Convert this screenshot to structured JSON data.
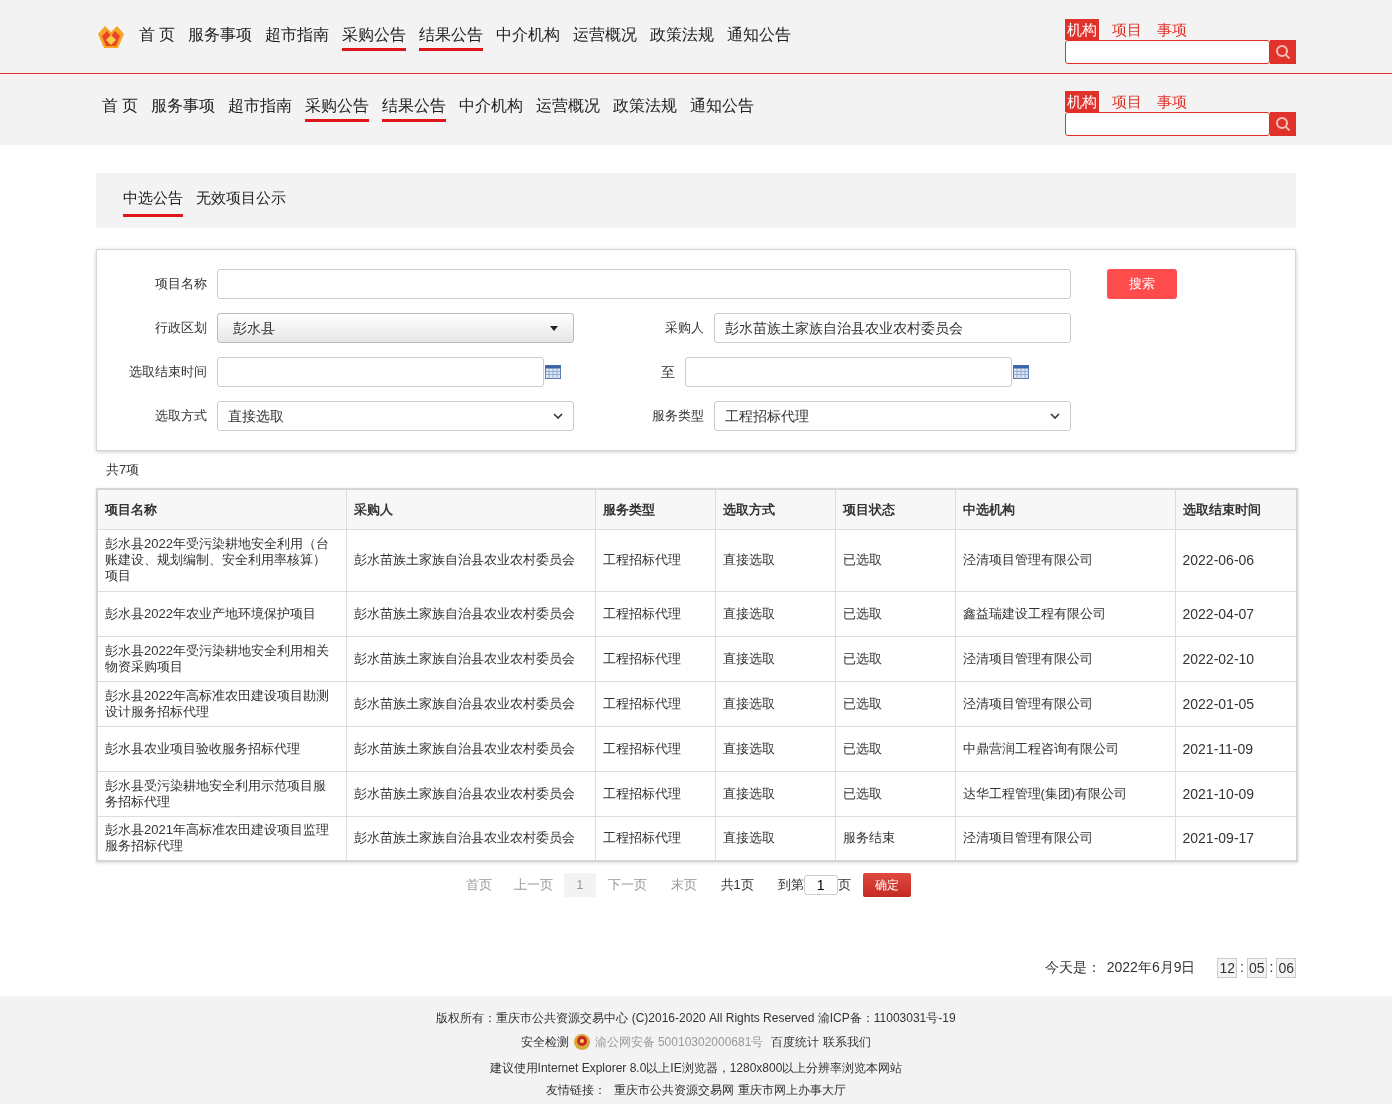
{
  "headers": [
    {
      "logo": true,
      "nav": [
        {
          "label": "首 页",
          "selected": false
        },
        {
          "label": "服务事项",
          "selected": false
        },
        {
          "label": "超市指南",
          "selected": false
        },
        {
          "label": "采购公告",
          "selected": true
        },
        {
          "label": "结果公告",
          "selected": true
        },
        {
          "label": "中介机构",
          "selected": false
        },
        {
          "label": "运营概况",
          "selected": false
        },
        {
          "label": "政策法规",
          "selected": false
        },
        {
          "label": "通知公告",
          "selected": false
        }
      ],
      "search_tabs": [
        {
          "label": "机构",
          "selected": true
        },
        {
          "label": "项目",
          "selected": false
        },
        {
          "label": "事项",
          "selected": false
        }
      ]
    },
    {
      "logo": false,
      "nav": [
        {
          "label": "首 页",
          "selected": false
        },
        {
          "label": "服务事项",
          "selected": false
        },
        {
          "label": "超市指南",
          "selected": false
        },
        {
          "label": "采购公告",
          "selected": true
        },
        {
          "label": "结果公告",
          "selected": true
        },
        {
          "label": "中介机构",
          "selected": false
        },
        {
          "label": "运营概况",
          "selected": false
        },
        {
          "label": "政策法规",
          "selected": false
        },
        {
          "label": "通知公告",
          "selected": false
        }
      ],
      "search_tabs": [
        {
          "label": "机构",
          "selected": true
        },
        {
          "label": "项目",
          "selected": false
        },
        {
          "label": "事项",
          "selected": false
        }
      ]
    }
  ],
  "sub_tabs": [
    {
      "label": "中选公告",
      "selected": true
    },
    {
      "label": "无效项目公示",
      "selected": false
    }
  ],
  "search_form": {
    "project_name": {
      "label": "项目名称"
    },
    "search_button": "搜索",
    "region": {
      "label": "行政区划",
      "value": "彭水县"
    },
    "purchaser": {
      "label": "采购人",
      "value": "彭水苗族土家族自治县农业农村委员会"
    },
    "end_time": {
      "label": "选取结束时间"
    },
    "to_label": "至",
    "method": {
      "label": "选取方式",
      "value": "直接选取"
    },
    "service_type": {
      "label": "服务类型",
      "value": "工程招标代理"
    }
  },
  "result_count": "共7项",
  "table": {
    "columns": [
      "项目名称",
      "采购人",
      "服务类型",
      "选取方式",
      "项目状态",
      "中选机构",
      "选取结束时间"
    ],
    "rows": [
      [
        "彭水县2022年受污染耕地安全利用（台账建设、规划编制、安全利用率核算）项目",
        "彭水苗族土家族自治县农业农村委员会",
        "工程招标代理",
        "直接选取",
        "已选取",
        "泾清项目管理有限公司",
        "2022-06-06"
      ],
      [
        "彭水县2022年农业产地环境保护项目",
        "彭水苗族土家族自治县农业农村委员会",
        "工程招标代理",
        "直接选取",
        "已选取",
        "鑫益瑞建设工程有限公司",
        "2022-04-07"
      ],
      [
        "彭水县2022年受污染耕地安全利用相关物资采购项目",
        "彭水苗族土家族自治县农业农村委员会",
        "工程招标代理",
        "直接选取",
        "已选取",
        "泾清项目管理有限公司",
        "2022-02-10"
      ],
      [
        "彭水县2022年高标准农田建设项目勘测设计服务招标代理",
        "彭水苗族土家族自治县农业农村委员会",
        "工程招标代理",
        "直接选取",
        "已选取",
        "泾清项目管理有限公司",
        "2022-01-05"
      ],
      [
        "彭水县农业项目验收服务招标代理",
        "彭水苗族土家族自治县农业农村委员会",
        "工程招标代理",
        "直接选取",
        "已选取",
        "中鼎营润工程咨询有限公司",
        "2021-11-09"
      ],
      [
        "彭水县受污染耕地安全利用示范项目服务招标代理",
        "彭水苗族土家族自治县农业农村委员会",
        "工程招标代理",
        "直接选取",
        "已选取",
        "达华工程管理(集团)有限公司",
        "2021-10-09"
      ],
      [
        "彭水县2021年高标准农田建设项目监理服务招标代理",
        "彭水苗族土家族自治县农业农村委员会",
        "工程招标代理",
        "直接选取",
        "服务结束",
        "泾清项目管理有限公司",
        "2021-09-17"
      ]
    ]
  },
  "pagination": {
    "links": [
      {
        "label": "首页",
        "disabled": true
      },
      {
        "label": "上一页",
        "disabled": true
      }
    ],
    "current": "1",
    "links_after": [
      {
        "label": "下一页",
        "disabled": true
      },
      {
        "label": "末页",
        "disabled": true
      },
      {
        "label": "共1页",
        "disabled": false
      }
    ],
    "goto_prefix": "到第",
    "goto_value": "1",
    "goto_suffix": "页",
    "confirm": "确定"
  },
  "today": {
    "label": "今天是：",
    "date": "2022年6月9日",
    "clock": [
      {
        "kind": "box",
        "text": "12"
      },
      {
        "kind": "sep",
        "text": ":"
      },
      {
        "kind": "box",
        "text": "05"
      },
      {
        "kind": "sep",
        "text": ":"
      },
      {
        "kind": "box",
        "text": "06"
      }
    ]
  },
  "footer": {
    "copyright": "版权所有：重庆市公共资源交易中心 (C)2016-2020 All Rights Reserved 渝ICP备：11003031号-19",
    "security": "安全检测",
    "police_record": "渝公网安备 50010302000681号",
    "stats_link": "百度统计",
    "contact_link": "联系我们",
    "browser_note": "建议使用Internet Explorer 8.0以上IE浏览器，1280x800以上分辨率浏览本网站",
    "links_label": "友情链接：",
    "links": [
      "重庆市公共资源交易网",
      "重庆市网上办事大厅"
    ]
  }
}
